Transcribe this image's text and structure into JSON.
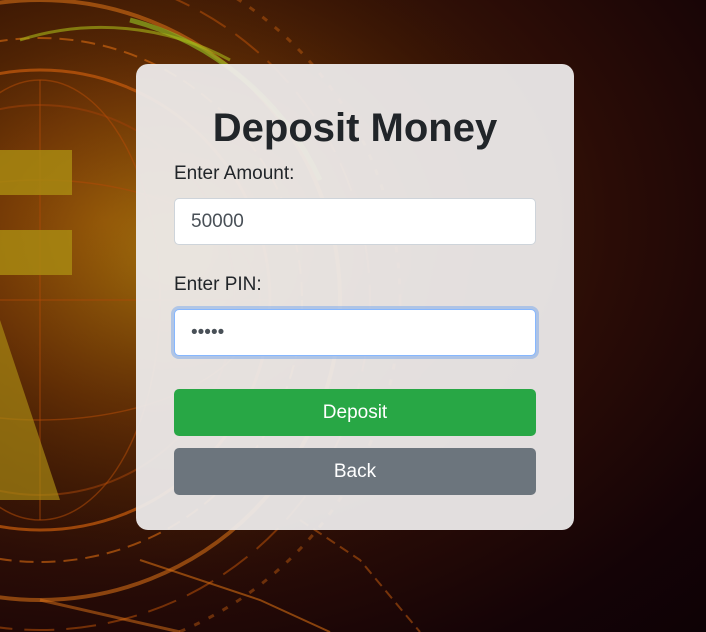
{
  "form": {
    "title": "Deposit Money",
    "amount_label": "Enter Amount:",
    "amount_value": "50000",
    "pin_label": "Enter PIN:",
    "pin_value": "12345"
  },
  "buttons": {
    "deposit_label": "Deposit",
    "back_label": "Back"
  },
  "colors": {
    "deposit_button": "#28a745",
    "back_button": "#6c757d",
    "card_background": "#eeecec",
    "focus_ring": "#86b7fe"
  },
  "background": {
    "icon": "rupee-coin-circuit-icon"
  }
}
